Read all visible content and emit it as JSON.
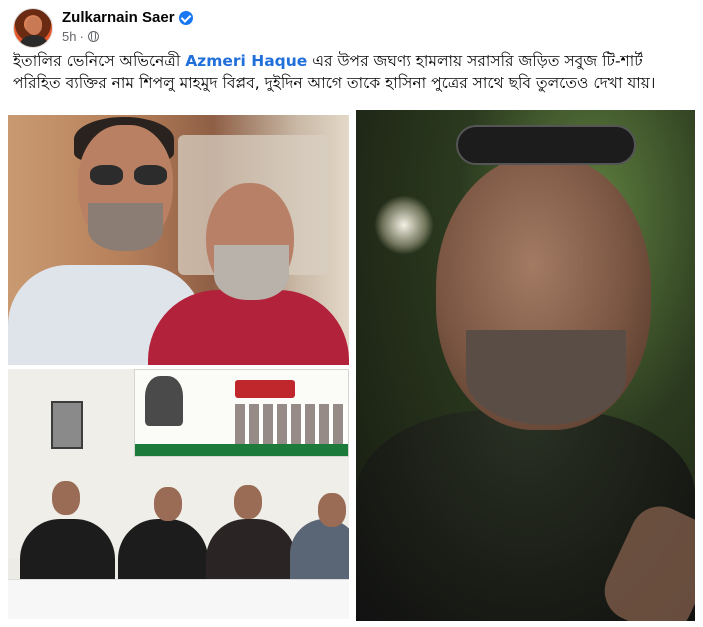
{
  "post": {
    "author": "Zulkarnain Saer",
    "time": "5h",
    "separator": "·",
    "text_before_link": "ইতালির ভেনিসে অভিনেত্রী ",
    "link_text": "Azmeri Haque",
    "text_after_link": " এর উপর জঘণ্য হামলায় সরাসরি জড়িত সবুজ টি-শার্ট পরিহিত ব্যক্তির নাম শিপলু মাহমুদ বিপ্লব, দুইদিন আগে তাকে হাসিনা পুত্রের সাথে ছবি তুলতেও দেখা যায়।"
  },
  "icons": {
    "avatar": "profile-avatar",
    "verified": "verified-badge-icon",
    "audience": "globe-icon"
  },
  "colors": {
    "link": "#216fdb",
    "verified": "#1877f2",
    "meta": "#65676b"
  }
}
